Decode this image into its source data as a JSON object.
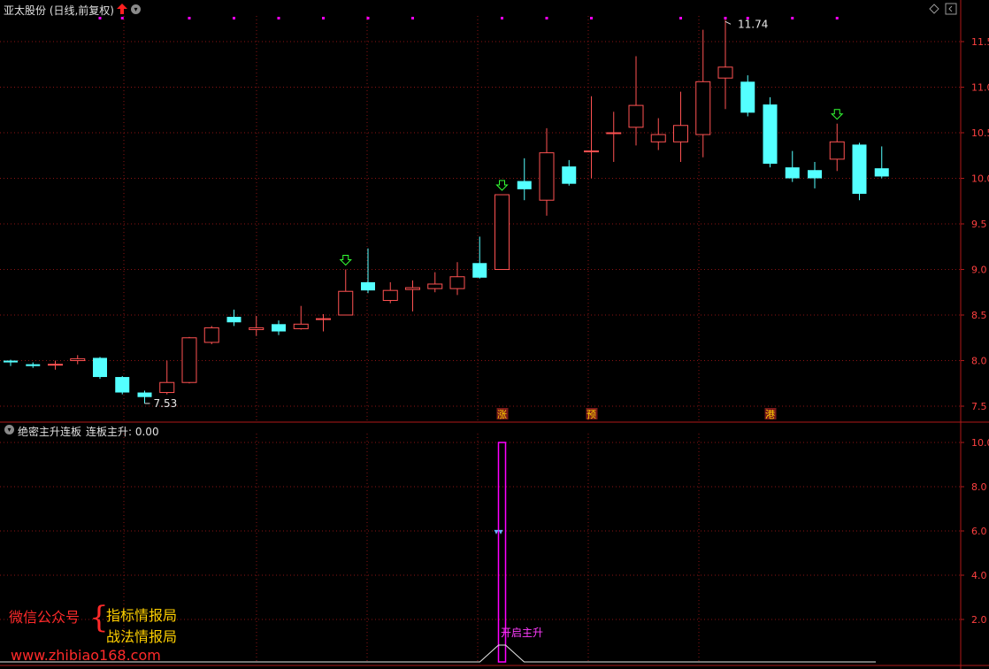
{
  "header": {
    "stock_title": "亚太股份 (日线,前复权)",
    "icons": [
      "red-up-arrow-icon",
      "chevron-down-icon",
      "diamond-icon",
      "panel-toggle-icon"
    ]
  },
  "indicator": {
    "title": "绝密主升连板",
    "value_text": "连板主升: 0.00",
    "signal_label": "开启主升"
  },
  "watermark": {
    "line1": "微信公众号",
    "brace": "{",
    "line2": "指标情报局",
    "line3": "战法情报局",
    "url": "www.zhibiao168.com"
  },
  "colors": {
    "up": "#ff5252",
    "down": "#54ffff",
    "grid": "#8b1414",
    "axis_text": "#ff4040",
    "magenta": "#ff00ff"
  },
  "chart_data": [
    {
      "type": "candlestick",
      "ylim": [
        7.4,
        11.8
      ],
      "yticks": [
        "11.5",
        "11.0",
        "10.5",
        "10.0",
        "9.5",
        "9.0",
        "8.5",
        "8.0",
        "7.5"
      ],
      "candles": [
        {
          "o": 8.0,
          "h": 8.01,
          "l": 7.94,
          "c": 7.98
        },
        {
          "o": 7.96,
          "h": 7.98,
          "l": 7.92,
          "c": 7.94
        },
        {
          "o": 7.96,
          "h": 8.0,
          "l": 7.9,
          "c": 7.96
        },
        {
          "o": 8.0,
          "h": 8.06,
          "l": 7.96,
          "c": 8.02
        },
        {
          "o": 8.03,
          "h": 8.04,
          "l": 7.8,
          "c": 7.82
        },
        {
          "o": 7.82,
          "h": 7.83,
          "l": 7.63,
          "c": 7.65
        },
        {
          "o": 7.65,
          "h": 7.67,
          "l": 7.53,
          "c": 7.6
        },
        {
          "o": 7.65,
          "h": 8.0,
          "l": 7.63,
          "c": 7.76
        },
        {
          "o": 7.76,
          "h": 8.26,
          "l": 7.75,
          "c": 8.25
        },
        {
          "o": 8.2,
          "h": 8.38,
          "l": 8.18,
          "c": 8.36
        },
        {
          "o": 8.48,
          "h": 8.56,
          "l": 8.38,
          "c": 8.42
        },
        {
          "o": 8.34,
          "h": 8.49,
          "l": 8.27,
          "c": 8.36
        },
        {
          "o": 8.4,
          "h": 8.44,
          "l": 8.28,
          "c": 8.32
        },
        {
          "o": 8.35,
          "h": 8.6,
          "l": 8.34,
          "c": 8.4
        },
        {
          "o": 8.46,
          "h": 8.51,
          "l": 8.32,
          "c": 8.46
        },
        {
          "o": 8.5,
          "h": 9.0,
          "l": 8.5,
          "c": 8.76
        },
        {
          "o": 8.86,
          "h": 9.23,
          "l": 8.74,
          "c": 8.77
        },
        {
          "o": 8.66,
          "h": 8.86,
          "l": 8.63,
          "c": 8.77
        },
        {
          "o": 8.78,
          "h": 8.88,
          "l": 8.54,
          "c": 8.8
        },
        {
          "o": 8.79,
          "h": 8.97,
          "l": 8.75,
          "c": 8.84
        },
        {
          "o": 8.79,
          "h": 9.08,
          "l": 8.72,
          "c": 8.92
        },
        {
          "o": 9.07,
          "h": 9.36,
          "l": 8.9,
          "c": 8.91
        },
        {
          "o": 9.0,
          "h": 9.82,
          "l": 9.0,
          "c": 9.82
        },
        {
          "o": 9.97,
          "h": 10.22,
          "l": 9.76,
          "c": 9.88
        },
        {
          "o": 9.76,
          "h": 10.55,
          "l": 9.59,
          "c": 10.28
        },
        {
          "o": 10.13,
          "h": 10.2,
          "l": 9.92,
          "c": 9.94
        },
        {
          "o": 10.3,
          "h": 10.9,
          "l": 10.0,
          "c": 10.3
        },
        {
          "o": 10.5,
          "h": 10.73,
          "l": 10.18,
          "c": 10.5
        },
        {
          "o": 10.56,
          "h": 11.34,
          "l": 10.36,
          "c": 10.8
        },
        {
          "o": 10.4,
          "h": 10.66,
          "l": 10.31,
          "c": 10.48
        },
        {
          "o": 10.4,
          "h": 10.95,
          "l": 10.18,
          "c": 10.58
        },
        {
          "o": 10.48,
          "h": 11.63,
          "l": 10.23,
          "c": 11.06
        },
        {
          "o": 11.1,
          "h": 11.74,
          "l": 10.76,
          "c": 11.22
        },
        {
          "o": 11.06,
          "h": 11.13,
          "l": 10.68,
          "c": 10.72
        },
        {
          "o": 10.81,
          "h": 10.89,
          "l": 10.12,
          "c": 10.16
        },
        {
          "o": 10.12,
          "h": 10.3,
          "l": 9.96,
          "c": 10.0
        },
        {
          "o": 10.09,
          "h": 10.18,
          "l": 9.89,
          "c": 10.0
        },
        {
          "o": 10.21,
          "h": 10.6,
          "l": 10.08,
          "c": 10.4
        },
        {
          "o": 10.37,
          "h": 10.39,
          "l": 9.76,
          "c": 9.83
        },
        {
          "o": 10.11,
          "h": 10.35,
          "l": 10.0,
          "c": 10.02
        }
      ],
      "annotations": {
        "high_label": "11.74",
        "low_label": "7.53",
        "markers": [
          "涨",
          "预",
          "港"
        ]
      }
    },
    {
      "type": "bar",
      "ylim": [
        0,
        10.0
      ],
      "yticks": [
        "10.0",
        "8.0",
        "6.0",
        "4.0",
        "2.0"
      ],
      "bar_index": 22,
      "bar_value": 10.0,
      "current_value": 0.0
    }
  ]
}
